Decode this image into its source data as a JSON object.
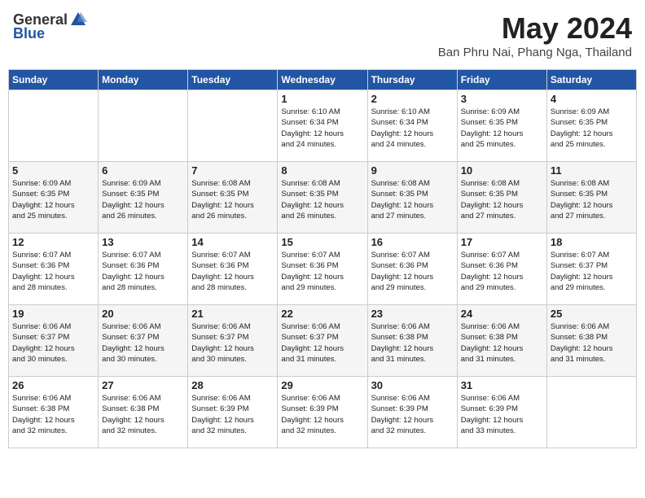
{
  "header": {
    "logo_general": "General",
    "logo_blue": "Blue",
    "month_title": "May 2024",
    "location": "Ban Phru Nai, Phang Nga, Thailand"
  },
  "calendar": {
    "days_of_week": [
      "Sunday",
      "Monday",
      "Tuesday",
      "Wednesday",
      "Thursday",
      "Friday",
      "Saturday"
    ],
    "weeks": [
      [
        {
          "day": "",
          "detail": ""
        },
        {
          "day": "",
          "detail": ""
        },
        {
          "day": "",
          "detail": ""
        },
        {
          "day": "1",
          "detail": "Sunrise: 6:10 AM\nSunset: 6:34 PM\nDaylight: 12 hours\nand 24 minutes."
        },
        {
          "day": "2",
          "detail": "Sunrise: 6:10 AM\nSunset: 6:34 PM\nDaylight: 12 hours\nand 24 minutes."
        },
        {
          "day": "3",
          "detail": "Sunrise: 6:09 AM\nSunset: 6:35 PM\nDaylight: 12 hours\nand 25 minutes."
        },
        {
          "day": "4",
          "detail": "Sunrise: 6:09 AM\nSunset: 6:35 PM\nDaylight: 12 hours\nand 25 minutes."
        }
      ],
      [
        {
          "day": "5",
          "detail": "Sunrise: 6:09 AM\nSunset: 6:35 PM\nDaylight: 12 hours\nand 25 minutes."
        },
        {
          "day": "6",
          "detail": "Sunrise: 6:09 AM\nSunset: 6:35 PM\nDaylight: 12 hours\nand 26 minutes."
        },
        {
          "day": "7",
          "detail": "Sunrise: 6:08 AM\nSunset: 6:35 PM\nDaylight: 12 hours\nand 26 minutes."
        },
        {
          "day": "8",
          "detail": "Sunrise: 6:08 AM\nSunset: 6:35 PM\nDaylight: 12 hours\nand 26 minutes."
        },
        {
          "day": "9",
          "detail": "Sunrise: 6:08 AM\nSunset: 6:35 PM\nDaylight: 12 hours\nand 27 minutes."
        },
        {
          "day": "10",
          "detail": "Sunrise: 6:08 AM\nSunset: 6:35 PM\nDaylight: 12 hours\nand 27 minutes."
        },
        {
          "day": "11",
          "detail": "Sunrise: 6:08 AM\nSunset: 6:35 PM\nDaylight: 12 hours\nand 27 minutes."
        }
      ],
      [
        {
          "day": "12",
          "detail": "Sunrise: 6:07 AM\nSunset: 6:36 PM\nDaylight: 12 hours\nand 28 minutes."
        },
        {
          "day": "13",
          "detail": "Sunrise: 6:07 AM\nSunset: 6:36 PM\nDaylight: 12 hours\nand 28 minutes."
        },
        {
          "day": "14",
          "detail": "Sunrise: 6:07 AM\nSunset: 6:36 PM\nDaylight: 12 hours\nand 28 minutes."
        },
        {
          "day": "15",
          "detail": "Sunrise: 6:07 AM\nSunset: 6:36 PM\nDaylight: 12 hours\nand 29 minutes."
        },
        {
          "day": "16",
          "detail": "Sunrise: 6:07 AM\nSunset: 6:36 PM\nDaylight: 12 hours\nand 29 minutes."
        },
        {
          "day": "17",
          "detail": "Sunrise: 6:07 AM\nSunset: 6:36 PM\nDaylight: 12 hours\nand 29 minutes."
        },
        {
          "day": "18",
          "detail": "Sunrise: 6:07 AM\nSunset: 6:37 PM\nDaylight: 12 hours\nand 29 minutes."
        }
      ],
      [
        {
          "day": "19",
          "detail": "Sunrise: 6:06 AM\nSunset: 6:37 PM\nDaylight: 12 hours\nand 30 minutes."
        },
        {
          "day": "20",
          "detail": "Sunrise: 6:06 AM\nSunset: 6:37 PM\nDaylight: 12 hours\nand 30 minutes."
        },
        {
          "day": "21",
          "detail": "Sunrise: 6:06 AM\nSunset: 6:37 PM\nDaylight: 12 hours\nand 30 minutes."
        },
        {
          "day": "22",
          "detail": "Sunrise: 6:06 AM\nSunset: 6:37 PM\nDaylight: 12 hours\nand 31 minutes."
        },
        {
          "day": "23",
          "detail": "Sunrise: 6:06 AM\nSunset: 6:38 PM\nDaylight: 12 hours\nand 31 minutes."
        },
        {
          "day": "24",
          "detail": "Sunrise: 6:06 AM\nSunset: 6:38 PM\nDaylight: 12 hours\nand 31 minutes."
        },
        {
          "day": "25",
          "detail": "Sunrise: 6:06 AM\nSunset: 6:38 PM\nDaylight: 12 hours\nand 31 minutes."
        }
      ],
      [
        {
          "day": "26",
          "detail": "Sunrise: 6:06 AM\nSunset: 6:38 PM\nDaylight: 12 hours\nand 32 minutes."
        },
        {
          "day": "27",
          "detail": "Sunrise: 6:06 AM\nSunset: 6:38 PM\nDaylight: 12 hours\nand 32 minutes."
        },
        {
          "day": "28",
          "detail": "Sunrise: 6:06 AM\nSunset: 6:39 PM\nDaylight: 12 hours\nand 32 minutes."
        },
        {
          "day": "29",
          "detail": "Sunrise: 6:06 AM\nSunset: 6:39 PM\nDaylight: 12 hours\nand 32 minutes."
        },
        {
          "day": "30",
          "detail": "Sunrise: 6:06 AM\nSunset: 6:39 PM\nDaylight: 12 hours\nand 32 minutes."
        },
        {
          "day": "31",
          "detail": "Sunrise: 6:06 AM\nSunset: 6:39 PM\nDaylight: 12 hours\nand 33 minutes."
        },
        {
          "day": "",
          "detail": ""
        }
      ]
    ]
  }
}
